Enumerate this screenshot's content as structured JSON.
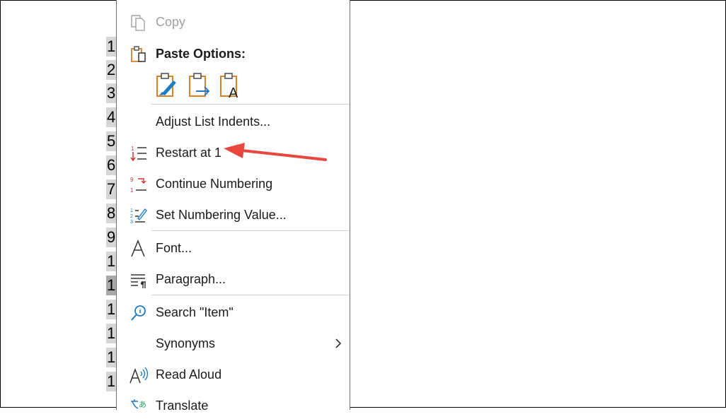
{
  "doc_numbers": [
    "1",
    "2",
    "3",
    "4",
    "5",
    "6",
    "7",
    "8",
    "9",
    "1",
    "1",
    "1",
    "1",
    "1",
    "1"
  ],
  "menu": {
    "copy": "Copy",
    "paste_options": "Paste Options:",
    "adjust_list_indents": "Adjust List Indents...",
    "restart_at_1": "Restart at 1",
    "continue_numbering": "Continue Numbering",
    "set_numbering_value": "Set Numbering Value...",
    "font": "Font...",
    "paragraph": "Paragraph...",
    "search": "Search \"Item\"",
    "synonyms": "Synonyms",
    "read_aloud": "Read Aloud",
    "translate": "Translate"
  },
  "icons": {
    "copy": "copy-icon",
    "paste_options": "clipboard-icon",
    "paste_keep_formatting": "paste-keep-formatting-icon",
    "paste_merge": "paste-merge-formatting-icon",
    "paste_text_only": "paste-text-only-icon",
    "restart": "restart-numbering-icon",
    "continue": "continue-numbering-icon",
    "set_value": "set-numbering-value-icon",
    "font": "font-icon",
    "paragraph": "paragraph-icon",
    "search": "search-icon",
    "synonyms_submenu": "chevron-right-icon",
    "read_aloud": "read-aloud-icon",
    "translate": "translate-icon"
  },
  "colors": {
    "accent_orange": "#d9822b",
    "accent_blue": "#1e7bc4",
    "accent_red": "#d13438",
    "annotation_arrow": "#e8473f"
  }
}
